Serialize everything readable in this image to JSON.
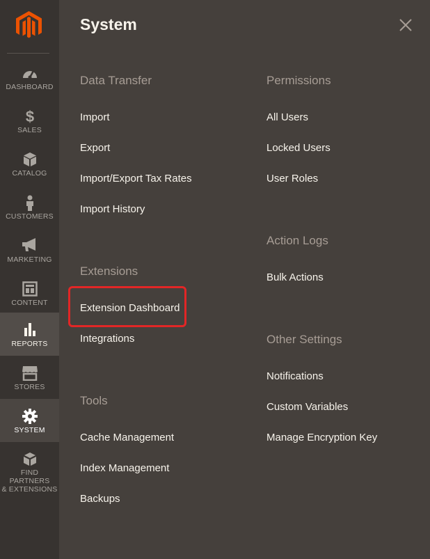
{
  "sidebar": {
    "logo": "magento-logo",
    "items": [
      {
        "label": "DASHBOARD",
        "icon": "dashboard-icon"
      },
      {
        "label": "SALES",
        "icon": "dollar-icon"
      },
      {
        "label": "CATALOG",
        "icon": "cube-icon"
      },
      {
        "label": "CUSTOMERS",
        "icon": "person-icon"
      },
      {
        "label": "MARKETING",
        "icon": "megaphone-icon"
      },
      {
        "label": "CONTENT",
        "icon": "layout-icon"
      },
      {
        "label": "REPORTS",
        "icon": "bar-chart-icon"
      },
      {
        "label": "STORES",
        "icon": "storefront-icon"
      },
      {
        "label": "SYSTEM",
        "icon": "gear-icon"
      },
      {
        "label": "FIND PARTNERS & EXTENSIONS",
        "label_line1": "FIND PARTNERS",
        "label_line2": "& EXTENSIONS",
        "icon": "boxes-icon"
      }
    ]
  },
  "panel": {
    "title": "System",
    "close_icon": "close-icon",
    "sections": {
      "data_transfer": {
        "title": "Data Transfer",
        "links": [
          "Import",
          "Export",
          "Import/Export Tax Rates",
          "Import History"
        ]
      },
      "extensions": {
        "title": "Extensions",
        "links": [
          "Extension Dashboard",
          "Integrations"
        ]
      },
      "tools": {
        "title": "Tools",
        "links": [
          "Cache Management",
          "Index Management",
          "Backups"
        ]
      },
      "permissions": {
        "title": "Permissions",
        "links": [
          "All Users",
          "Locked Users",
          "User Roles"
        ]
      },
      "action_logs": {
        "title": "Action Logs",
        "links": [
          "Bulk Actions"
        ]
      },
      "other_settings": {
        "title": "Other Settings",
        "links": [
          "Notifications",
          "Custom Variables",
          "Manage Encryption Key"
        ]
      }
    }
  },
  "colors": {
    "sidebar_bg": "#373330",
    "panel_bg": "#45403c",
    "brand_orange": "#eb5202",
    "highlight_red": "#e22626"
  }
}
